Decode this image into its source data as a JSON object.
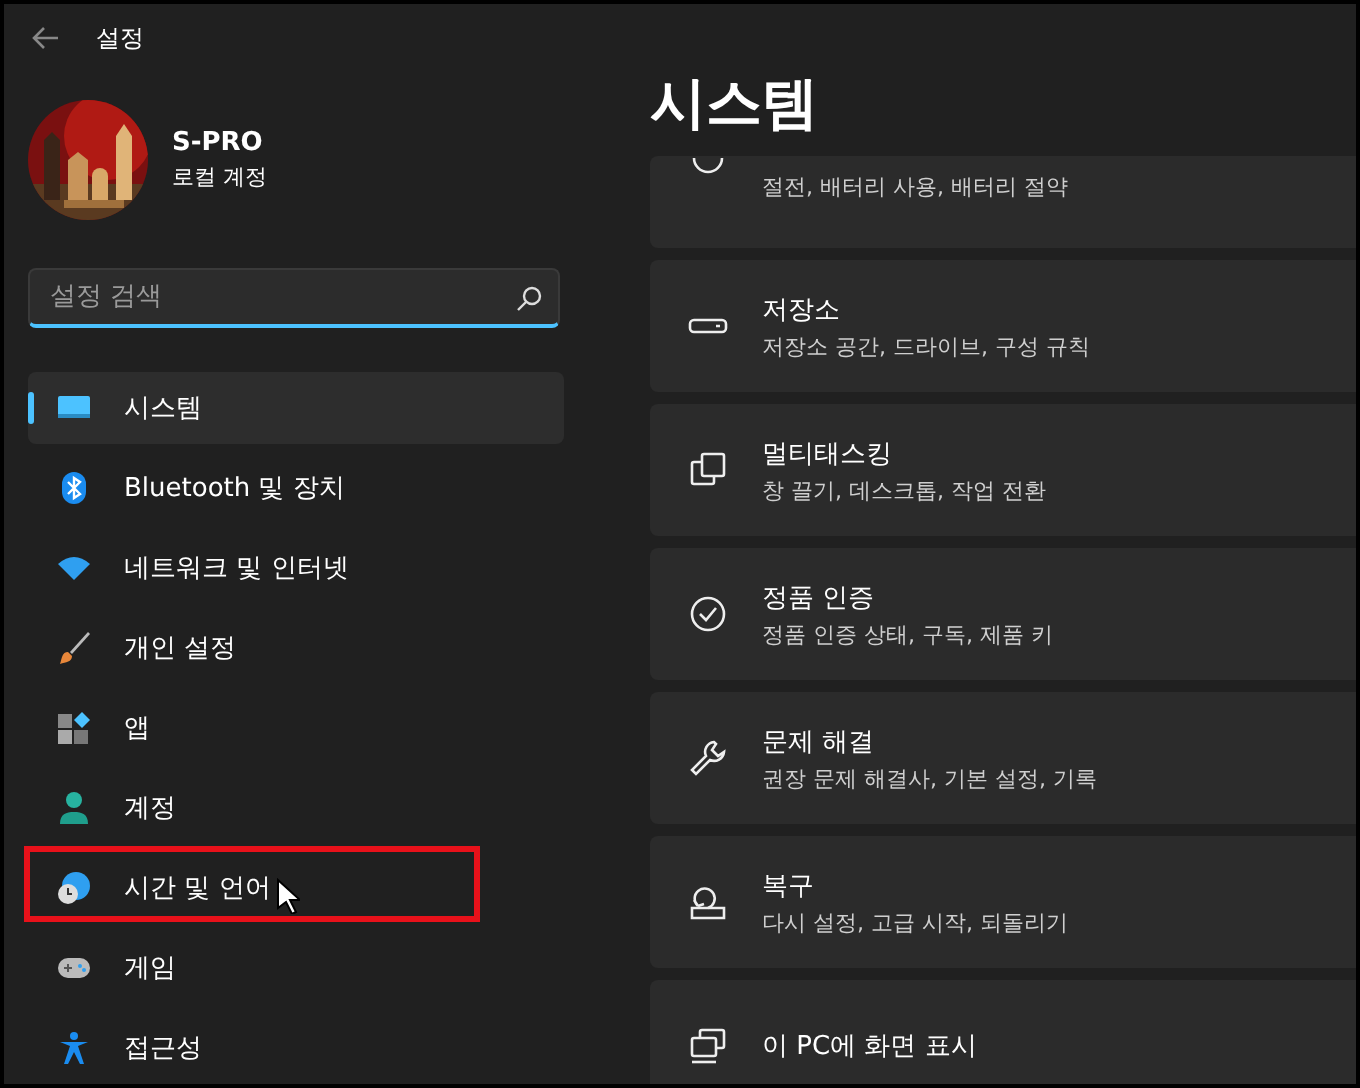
{
  "window": {
    "title": "설정"
  },
  "account": {
    "name": "S-PRO",
    "type": "로컬 계정"
  },
  "search": {
    "placeholder": "설정 검색"
  },
  "nav": [
    {
      "label": "시스템",
      "kind": "system",
      "selected": true,
      "highlighted": false
    },
    {
      "label": "Bluetooth 및 장치",
      "kind": "bluetooth",
      "selected": false,
      "highlighted": false
    },
    {
      "label": "네트워크 및 인터넷",
      "kind": "wifi",
      "selected": false,
      "highlighted": false
    },
    {
      "label": "개인 설정",
      "kind": "brush",
      "selected": false,
      "highlighted": false
    },
    {
      "label": "앱",
      "kind": "apps",
      "selected": false,
      "highlighted": false
    },
    {
      "label": "계정",
      "kind": "person",
      "selected": false,
      "highlighted": false
    },
    {
      "label": "시간 및 언어",
      "kind": "time",
      "selected": false,
      "highlighted": true
    },
    {
      "label": "게임",
      "kind": "game",
      "selected": false,
      "highlighted": false
    },
    {
      "label": "접근성",
      "kind": "access",
      "selected": false,
      "highlighted": false
    }
  ],
  "page": {
    "title": "시스템"
  },
  "cards": [
    {
      "kind": "power",
      "subtitle": "절전, 배터리 사용, 배터리 절약"
    },
    {
      "kind": "storage",
      "title": "저장소",
      "subtitle": "저장소 공간, 드라이브, 구성 규칙"
    },
    {
      "kind": "multitask",
      "title": "멀티태스킹",
      "subtitle": "창 끌기, 데스크톱, 작업 전환"
    },
    {
      "kind": "activation",
      "title": "정품 인증",
      "subtitle": "정품 인증 상태, 구독, 제품 키"
    },
    {
      "kind": "wrench",
      "title": "문제 해결",
      "subtitle": "권장 문제 해결사, 기본 설정, 기록"
    },
    {
      "kind": "recovery",
      "title": "복구",
      "subtitle": "다시 설정, 고급 시작, 되돌리기"
    },
    {
      "kind": "project",
      "title": "이 PC에 화면 표시"
    }
  ]
}
